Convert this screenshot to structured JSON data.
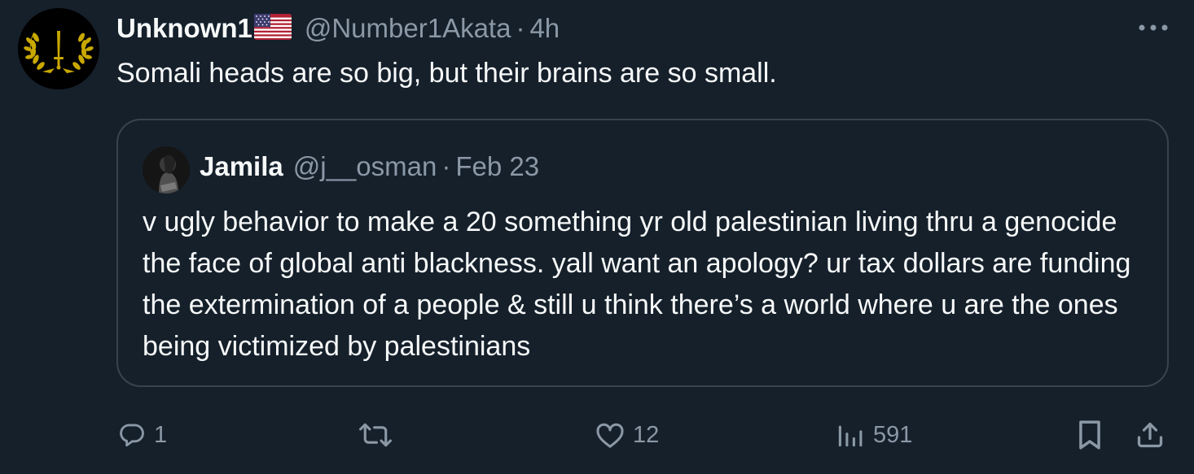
{
  "tweet": {
    "author": {
      "display_name": "Unknown1",
      "flag": "us-flag-emoji",
      "handle": "@Number1Akata",
      "separator": "·",
      "time": "4h"
    },
    "text": "Somali heads are so big, but their brains are so small.",
    "more_icon": "more-horizontal-icon"
  },
  "quote": {
    "author": {
      "display_name": "Jamila",
      "handle": "@j__osman",
      "separator": "·",
      "time": "Feb 23"
    },
    "text": "v ugly behavior to make a 20 something yr old palestinian living thru a genocide the face of global anti blackness. yall want an apology? ur tax dollars are funding the extermination of a people & still u think there’s a world where u are the ones being victimized by palestinians"
  },
  "actions": {
    "reply": {
      "icon": "reply-icon",
      "count": "1"
    },
    "retweet": {
      "icon": "retweet-icon",
      "count": ""
    },
    "like": {
      "icon": "heart-icon",
      "count": "12"
    },
    "views": {
      "icon": "views-icon",
      "count": "591"
    },
    "bookmark": {
      "icon": "bookmark-icon"
    },
    "share": {
      "icon": "share-icon"
    }
  },
  "colors": {
    "background": "#15202b",
    "text": "#f7f9f9",
    "secondary": "#8b98a5",
    "border": "#38444d"
  }
}
